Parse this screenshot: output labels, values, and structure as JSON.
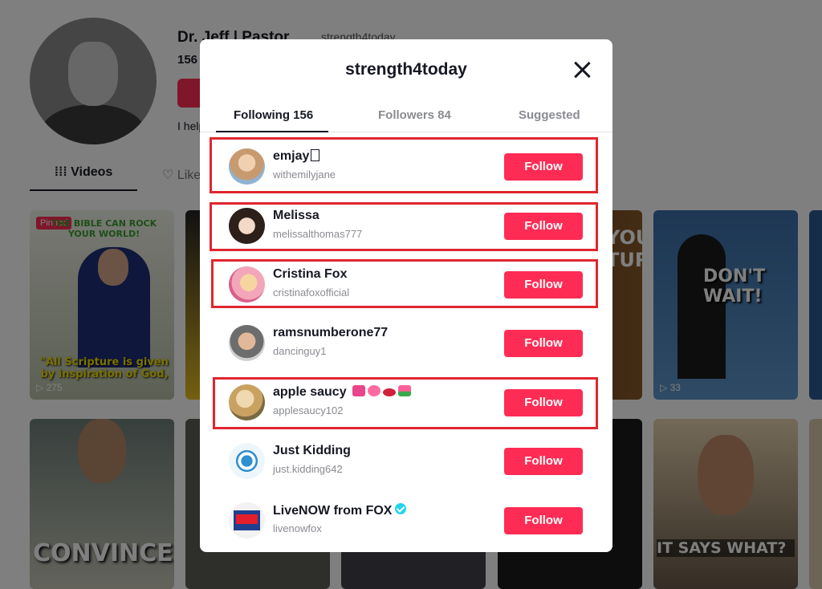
{
  "profile": {
    "name": "Dr. Jeff | Pastor",
    "handle": "strength4today",
    "stat": "156",
    "bio": "I help",
    "tabs": {
      "videos": "Videos",
      "liked": "Liked"
    }
  },
  "thumbnails": [
    {
      "pinned": "Pinned",
      "top_text": "THE BIBLE CAN ROCK YOUR WORLD!",
      "bottom_text": "\"All Scripture is given by inspiration of God,",
      "views": "▷ 275"
    },
    {
      "views": ""
    },
    {
      "text": "YOUR TURN"
    },
    {
      "text": "DON'T WAIT!",
      "views": "▷ 33"
    },
    {
      "text": "CONVINCED?"
    },
    {
      "text": "IT SAYS WHAT?"
    }
  ],
  "modal": {
    "title": "strength4today",
    "tabs": [
      {
        "label": "Following 156",
        "active": true
      },
      {
        "label": "Followers 84",
        "active": false
      },
      {
        "label": "Suggested",
        "active": false
      }
    ],
    "follow_label": "Follow",
    "accounts": [
      {
        "name": "emjay",
        "handle": "withemilyjane",
        "avatar_color": "#d9b48f",
        "highlighted": true
      },
      {
        "name": "Melissa",
        "handle": "melissalthomas777",
        "avatar_color": "#3b2a24",
        "highlighted": true
      },
      {
        "name": "Cristina Fox",
        "handle": "cristinafoxofficial",
        "avatar_color": "#f0a7b8",
        "highlighted": true
      },
      {
        "name": "ramsnumberone77",
        "handle": "dancinguy1",
        "avatar_color": "#8c7a6b",
        "highlighted": false
      },
      {
        "name": "apple saucy",
        "handle": "applesaucy102",
        "avatar_color": "#c8a060",
        "highlighted": true
      },
      {
        "name": "Just Kidding",
        "handle": "just.kidding642",
        "avatar_color": "#e9f4fb",
        "highlighted": false
      },
      {
        "name": "LiveNOW from FOX",
        "handle": "livenowfox",
        "avatar_color": "#1f3f8f",
        "highlighted": false,
        "verified": true
      }
    ]
  },
  "colors": {
    "accent": "#fe2c55",
    "highlight": "#e0262f",
    "verified": "#20d5ec"
  }
}
